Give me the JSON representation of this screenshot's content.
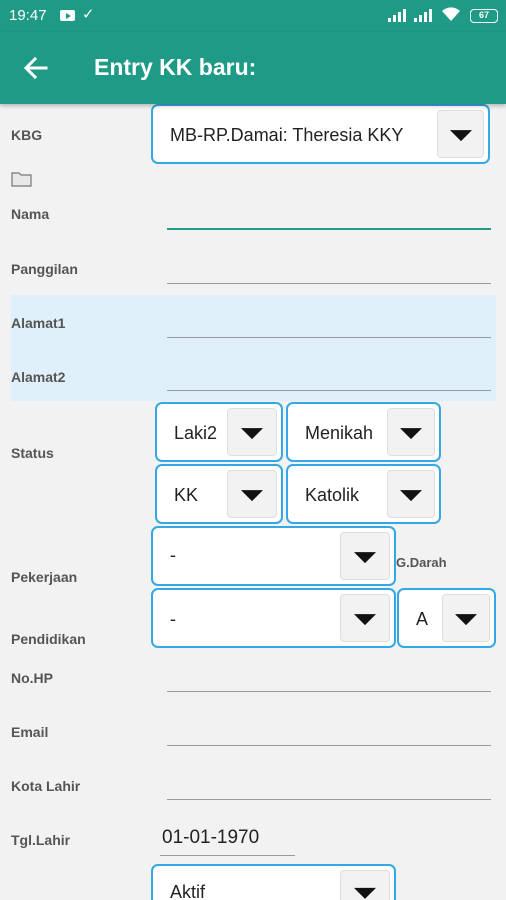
{
  "status_bar": {
    "time": "19:47",
    "battery": "67"
  },
  "app_bar": {
    "title": "Entry KK baru:"
  },
  "form": {
    "kbg_label": "KBG",
    "kbg_value": "MB-RP.Damai: Theresia KKY",
    "nama_label": "Nama",
    "panggilan_label": "Panggilan",
    "alamat1_label": "Alamat1",
    "alamat2_label": "Alamat2",
    "status_label": "Status",
    "gender_value": "Laki2",
    "marital_value": "Menikah",
    "family_role_value": "KK",
    "religion_value": "Katolik",
    "pekerjaan_label": "Pekerjaan",
    "pekerjaan_value": "-",
    "gdarah_label": "G.Darah",
    "pendidikan_label": "Pendidikan",
    "pendidikan_value": "-",
    "gdarah_value": "A",
    "nohp_label": "No.HP",
    "email_label": "Email",
    "kota_lahir_label": "Kota Lahir",
    "tgl_lahir_label": "Tgl.Lahir",
    "tgl_lahir_value": "01-01-1970",
    "active_value": "Aktif"
  },
  "colors": {
    "primary": "#1e9a86",
    "spinner_border": "#34a7e5",
    "address_bg": "#e0f0fb"
  }
}
